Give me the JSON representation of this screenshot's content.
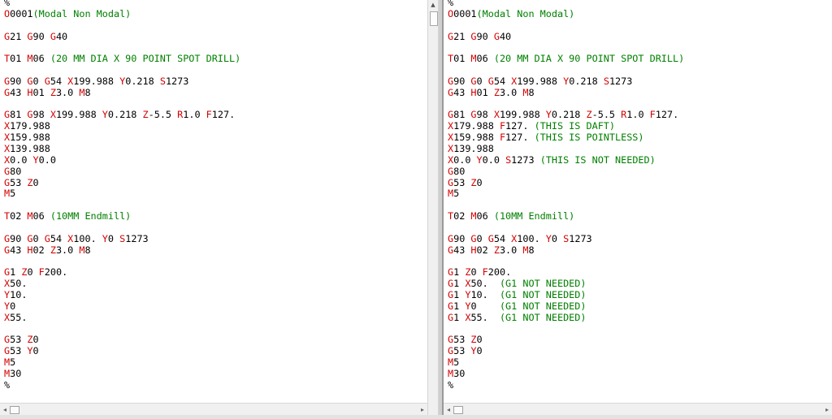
{
  "left_pane": {
    "lines": [
      [
        [
          "t",
          "%"
        ]
      ],
      [
        [
          "a",
          "O"
        ],
        [
          "t",
          "0001"
        ],
        [
          "c",
          "(Modal Non Modal)"
        ]
      ],
      [],
      [
        [
          "a",
          "G"
        ],
        [
          "t",
          "21 "
        ],
        [
          "a",
          "G"
        ],
        [
          "t",
          "90 "
        ],
        [
          "a",
          "G"
        ],
        [
          "t",
          "40"
        ]
      ],
      [],
      [
        [
          "a",
          "T"
        ],
        [
          "t",
          "01 "
        ],
        [
          "a",
          "M"
        ],
        [
          "t",
          "06 "
        ],
        [
          "c",
          "(20 MM DIA X 90 POINT SPOT DRILL)"
        ]
      ],
      [],
      [
        [
          "a",
          "G"
        ],
        [
          "t",
          "90 "
        ],
        [
          "a",
          "G"
        ],
        [
          "t",
          "0 "
        ],
        [
          "a",
          "G"
        ],
        [
          "t",
          "54 "
        ],
        [
          "a",
          "X"
        ],
        [
          "t",
          "199.988 "
        ],
        [
          "a",
          "Y"
        ],
        [
          "t",
          "0.218 "
        ],
        [
          "a",
          "S"
        ],
        [
          "t",
          "1273"
        ]
      ],
      [
        [
          "a",
          "G"
        ],
        [
          "t",
          "43 "
        ],
        [
          "a",
          "H"
        ],
        [
          "t",
          "01 "
        ],
        [
          "a",
          "Z"
        ],
        [
          "t",
          "3.0 "
        ],
        [
          "a",
          "M"
        ],
        [
          "t",
          "8"
        ]
      ],
      [],
      [
        [
          "a",
          "G"
        ],
        [
          "t",
          "81 "
        ],
        [
          "a",
          "G"
        ],
        [
          "t",
          "98 "
        ],
        [
          "a",
          "X"
        ],
        [
          "t",
          "199.988 "
        ],
        [
          "a",
          "Y"
        ],
        [
          "t",
          "0.218 "
        ],
        [
          "a",
          "Z"
        ],
        [
          "t",
          "-5.5 "
        ],
        [
          "a",
          "R"
        ],
        [
          "t",
          "1.0 "
        ],
        [
          "a",
          "F"
        ],
        [
          "t",
          "127."
        ]
      ],
      [
        [
          "a",
          "X"
        ],
        [
          "t",
          "179.988"
        ]
      ],
      [
        [
          "a",
          "X"
        ],
        [
          "t",
          "159.988"
        ]
      ],
      [
        [
          "a",
          "X"
        ],
        [
          "t",
          "139.988"
        ]
      ],
      [
        [
          "a",
          "X"
        ],
        [
          "t",
          "0.0 "
        ],
        [
          "a",
          "Y"
        ],
        [
          "t",
          "0.0"
        ]
      ],
      [
        [
          "a",
          "G"
        ],
        [
          "t",
          "80"
        ]
      ],
      [
        [
          "a",
          "G"
        ],
        [
          "t",
          "53 "
        ],
        [
          "a",
          "Z"
        ],
        [
          "t",
          "0"
        ]
      ],
      [
        [
          "a",
          "M"
        ],
        [
          "t",
          "5"
        ]
      ],
      [],
      [
        [
          "a",
          "T"
        ],
        [
          "t",
          "02 "
        ],
        [
          "a",
          "M"
        ],
        [
          "t",
          "06 "
        ],
        [
          "c",
          "(10MM Endmill)"
        ]
      ],
      [],
      [
        [
          "a",
          "G"
        ],
        [
          "t",
          "90 "
        ],
        [
          "a",
          "G"
        ],
        [
          "t",
          "0 "
        ],
        [
          "a",
          "G"
        ],
        [
          "t",
          "54 "
        ],
        [
          "a",
          "X"
        ],
        [
          "t",
          "100. "
        ],
        [
          "a",
          "Y"
        ],
        [
          "t",
          "0 "
        ],
        [
          "a",
          "S"
        ],
        [
          "t",
          "1273"
        ]
      ],
      [
        [
          "a",
          "G"
        ],
        [
          "t",
          "43 "
        ],
        [
          "a",
          "H"
        ],
        [
          "t",
          "02 "
        ],
        [
          "a",
          "Z"
        ],
        [
          "t",
          "3.0 "
        ],
        [
          "a",
          "M"
        ],
        [
          "t",
          "8"
        ]
      ],
      [],
      [
        [
          "a",
          "G"
        ],
        [
          "t",
          "1 "
        ],
        [
          "a",
          "Z"
        ],
        [
          "t",
          "0 "
        ],
        [
          "a",
          "F"
        ],
        [
          "t",
          "200."
        ]
      ],
      [
        [
          "a",
          "X"
        ],
        [
          "t",
          "50."
        ]
      ],
      [
        [
          "a",
          "Y"
        ],
        [
          "t",
          "10."
        ]
      ],
      [
        [
          "a",
          "Y"
        ],
        [
          "t",
          "0"
        ]
      ],
      [
        [
          "a",
          "X"
        ],
        [
          "t",
          "55."
        ]
      ],
      [],
      [
        [
          "a",
          "G"
        ],
        [
          "t",
          "53 "
        ],
        [
          "a",
          "Z"
        ],
        [
          "t",
          "0"
        ]
      ],
      [
        [
          "a",
          "G"
        ],
        [
          "t",
          "53 "
        ],
        [
          "a",
          "Y"
        ],
        [
          "t",
          "0"
        ]
      ],
      [
        [
          "a",
          "M"
        ],
        [
          "t",
          "5"
        ]
      ],
      [
        [
          "a",
          "M"
        ],
        [
          "t",
          "30"
        ]
      ],
      [
        [
          "t",
          "%"
        ]
      ]
    ]
  },
  "right_pane": {
    "lines": [
      [
        [
          "t",
          "%"
        ]
      ],
      [
        [
          "a",
          "O"
        ],
        [
          "t",
          "0001"
        ],
        [
          "c",
          "(Modal Non Modal)"
        ]
      ],
      [],
      [
        [
          "a",
          "G"
        ],
        [
          "t",
          "21 "
        ],
        [
          "a",
          "G"
        ],
        [
          "t",
          "90 "
        ],
        [
          "a",
          "G"
        ],
        [
          "t",
          "40"
        ]
      ],
      [],
      [
        [
          "a",
          "T"
        ],
        [
          "t",
          "01 "
        ],
        [
          "a",
          "M"
        ],
        [
          "t",
          "06 "
        ],
        [
          "c",
          "(20 MM DIA X 90 POINT SPOT DRILL)"
        ]
      ],
      [],
      [
        [
          "a",
          "G"
        ],
        [
          "t",
          "90 "
        ],
        [
          "a",
          "G"
        ],
        [
          "t",
          "0 "
        ],
        [
          "a",
          "G"
        ],
        [
          "t",
          "54 "
        ],
        [
          "a",
          "X"
        ],
        [
          "t",
          "199.988 "
        ],
        [
          "a",
          "Y"
        ],
        [
          "t",
          "0.218 "
        ],
        [
          "a",
          "S"
        ],
        [
          "t",
          "1273"
        ]
      ],
      [
        [
          "a",
          "G"
        ],
        [
          "t",
          "43 "
        ],
        [
          "a",
          "H"
        ],
        [
          "t",
          "01 "
        ],
        [
          "a",
          "Z"
        ],
        [
          "t",
          "3.0 "
        ],
        [
          "a",
          "M"
        ],
        [
          "t",
          "8"
        ]
      ],
      [],
      [
        [
          "a",
          "G"
        ],
        [
          "t",
          "81 "
        ],
        [
          "a",
          "G"
        ],
        [
          "t",
          "98 "
        ],
        [
          "a",
          "X"
        ],
        [
          "t",
          "199.988 "
        ],
        [
          "a",
          "Y"
        ],
        [
          "t",
          "0.218 "
        ],
        [
          "a",
          "Z"
        ],
        [
          "t",
          "-5.5 "
        ],
        [
          "a",
          "R"
        ],
        [
          "t",
          "1.0 "
        ],
        [
          "a",
          "F"
        ],
        [
          "t",
          "127."
        ]
      ],
      [
        [
          "a",
          "X"
        ],
        [
          "t",
          "179.988 "
        ],
        [
          "a",
          "F"
        ],
        [
          "t",
          "127. "
        ],
        [
          "c",
          "(THIS IS DAFT)"
        ]
      ],
      [
        [
          "a",
          "X"
        ],
        [
          "t",
          "159.988 "
        ],
        [
          "a",
          "F"
        ],
        [
          "t",
          "127. "
        ],
        [
          "c",
          "(THIS IS POINTLESS)"
        ]
      ],
      [
        [
          "a",
          "X"
        ],
        [
          "t",
          "139.988"
        ]
      ],
      [
        [
          "a",
          "X"
        ],
        [
          "t",
          "0.0 "
        ],
        [
          "a",
          "Y"
        ],
        [
          "t",
          "0.0 "
        ],
        [
          "a",
          "S"
        ],
        [
          "t",
          "1273 "
        ],
        [
          "c",
          "(THIS IS NOT NEEDED)"
        ]
      ],
      [
        [
          "a",
          "G"
        ],
        [
          "t",
          "80"
        ]
      ],
      [
        [
          "a",
          "G"
        ],
        [
          "t",
          "53 "
        ],
        [
          "a",
          "Z"
        ],
        [
          "t",
          "0"
        ]
      ],
      [
        [
          "a",
          "M"
        ],
        [
          "t",
          "5"
        ]
      ],
      [],
      [
        [
          "a",
          "T"
        ],
        [
          "t",
          "02 "
        ],
        [
          "a",
          "M"
        ],
        [
          "t",
          "06 "
        ],
        [
          "c",
          "(10MM Endmill)"
        ]
      ],
      [],
      [
        [
          "a",
          "G"
        ],
        [
          "t",
          "90 "
        ],
        [
          "a",
          "G"
        ],
        [
          "t",
          "0 "
        ],
        [
          "a",
          "G"
        ],
        [
          "t",
          "54 "
        ],
        [
          "a",
          "X"
        ],
        [
          "t",
          "100. "
        ],
        [
          "a",
          "Y"
        ],
        [
          "t",
          "0 "
        ],
        [
          "a",
          "S"
        ],
        [
          "t",
          "1273"
        ]
      ],
      [
        [
          "a",
          "G"
        ],
        [
          "t",
          "43 "
        ],
        [
          "a",
          "H"
        ],
        [
          "t",
          "02 "
        ],
        [
          "a",
          "Z"
        ],
        [
          "t",
          "3.0 "
        ],
        [
          "a",
          "M"
        ],
        [
          "t",
          "8"
        ]
      ],
      [],
      [
        [
          "a",
          "G"
        ],
        [
          "t",
          "1 "
        ],
        [
          "a",
          "Z"
        ],
        [
          "t",
          "0 "
        ],
        [
          "a",
          "F"
        ],
        [
          "t",
          "200."
        ]
      ],
      [
        [
          "a",
          "G"
        ],
        [
          "t",
          "1 "
        ],
        [
          "a",
          "X"
        ],
        [
          "t",
          "50.  "
        ],
        [
          "c",
          "(G1 NOT NEEDED)"
        ]
      ],
      [
        [
          "a",
          "G"
        ],
        [
          "t",
          "1 "
        ],
        [
          "a",
          "Y"
        ],
        [
          "t",
          "10.  "
        ],
        [
          "c",
          "(G1 NOT NEEDED)"
        ]
      ],
      [
        [
          "a",
          "G"
        ],
        [
          "t",
          "1 "
        ],
        [
          "a",
          "Y"
        ],
        [
          "t",
          "0    "
        ],
        [
          "c",
          "(G1 NOT NEEDED)"
        ]
      ],
      [
        [
          "a",
          "G"
        ],
        [
          "t",
          "1 "
        ],
        [
          "a",
          "X"
        ],
        [
          "t",
          "55.  "
        ],
        [
          "c",
          "(G1 NOT NEEDED)"
        ]
      ],
      [],
      [
        [
          "a",
          "G"
        ],
        [
          "t",
          "53 "
        ],
        [
          "a",
          "Z"
        ],
        [
          "t",
          "0"
        ]
      ],
      [
        [
          "a",
          "G"
        ],
        [
          "t",
          "53 "
        ],
        [
          "a",
          "Y"
        ],
        [
          "t",
          "0"
        ]
      ],
      [
        [
          "a",
          "M"
        ],
        [
          "t",
          "5"
        ]
      ],
      [
        [
          "a",
          "M"
        ],
        [
          "t",
          "30"
        ]
      ],
      [
        [
          "t",
          "%"
        ]
      ]
    ]
  },
  "colors": {
    "address": "#d40000",
    "comment": "#008000",
    "text": "#000000"
  },
  "icons": {
    "scroll_up": "scroll-up-arrow-icon",
    "scroll_left": "scroll-left-arrow-icon",
    "scroll_right": "scroll-right-arrow-icon"
  }
}
